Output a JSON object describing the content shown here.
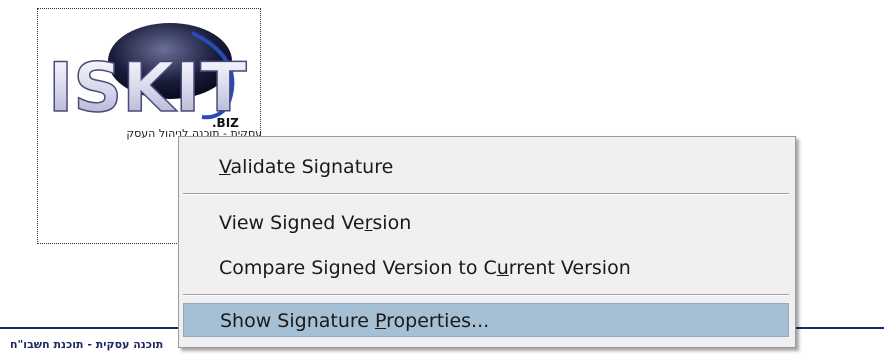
{
  "signature_field": {
    "logo_text": "ISKIT",
    "logo_suffix": ".BIZ",
    "caption": "עסקית - תוכנה לניהול העסק"
  },
  "footer": {
    "text": "תוכנה עסקית - תוכנת חשבו\"ח"
  },
  "context_menu": {
    "items": [
      {
        "pre": "",
        "u": "V",
        "post": "alidate Signature",
        "highlighted": false
      },
      {
        "pre": "View Signed Ve",
        "u": "r",
        "post": "sion",
        "highlighted": false
      },
      {
        "pre": "Compare Signed Version to C",
        "u": "u",
        "post": "rrent Version",
        "highlighted": false
      },
      {
        "pre": "Show Signature ",
        "u": "P",
        "post": "roperties...",
        "highlighted": true
      }
    ]
  },
  "colors": {
    "menu_background": "#f0f0f0",
    "highlight": "#a5bfd4",
    "rule": "#1c2a73"
  }
}
